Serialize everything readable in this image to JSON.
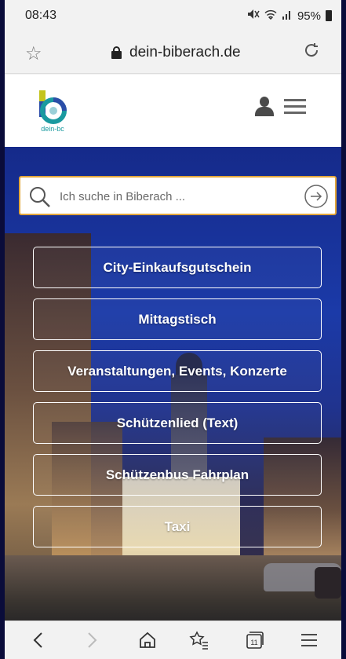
{
  "status_bar": {
    "time": "08:43",
    "battery": "95%"
  },
  "browser": {
    "url": "dein-biberach.de"
  },
  "site": {
    "logo_text": "dein-bc"
  },
  "search": {
    "placeholder": "Ich suche in Biberach ..."
  },
  "buttons": [
    {
      "label": "City-Einkaufsgutschein"
    },
    {
      "label": "Mittagstisch"
    },
    {
      "label": "Veranstaltungen, Events, Konzerte"
    },
    {
      "label": "Schützenlied (Text)"
    },
    {
      "label": "Schützenbus Fahrplan"
    },
    {
      "label": "Taxi"
    }
  ],
  "bottom_nav": {
    "tabs_count": "11"
  },
  "colors": {
    "search_border": "#e3a63a",
    "logo_teal": "#1a9aa0",
    "logo_blue": "#2b4ea8"
  }
}
